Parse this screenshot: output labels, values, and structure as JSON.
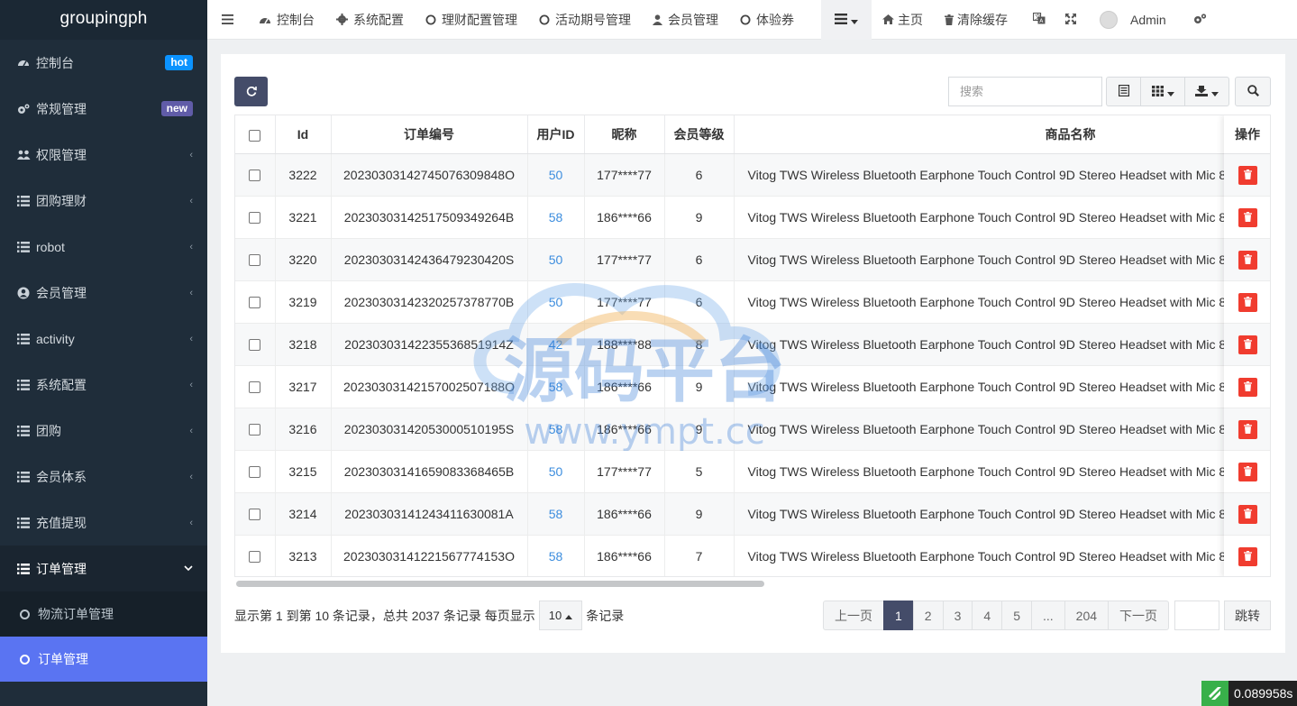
{
  "sidebar": {
    "logo": "groupingph",
    "items": [
      {
        "label": "控制台",
        "icon": "dashboard-icon",
        "badge": "hot"
      },
      {
        "label": "常规管理",
        "icon": "cogs-icon",
        "badge": "new"
      },
      {
        "label": "权限管理",
        "icon": "users-icon"
      },
      {
        "label": "团购理财",
        "icon": "list-icon"
      },
      {
        "label": "robot",
        "icon": "list-icon"
      },
      {
        "label": "会员管理",
        "icon": "user-circle-icon"
      },
      {
        "label": "activity",
        "icon": "list-icon"
      },
      {
        "label": "系统配置",
        "icon": "list-icon"
      },
      {
        "label": "团购",
        "icon": "list-icon"
      },
      {
        "label": "会员体系",
        "icon": "list-icon"
      },
      {
        "label": "充值提现",
        "icon": "list-icon"
      },
      {
        "label": "订单管理",
        "icon": "list-icon"
      }
    ],
    "subitems": [
      {
        "label": "物流订单管理"
      },
      {
        "label": "订单管理"
      }
    ]
  },
  "topbar": {
    "items": [
      "控制台",
      "系统配置",
      "理财配置管理",
      "活动期号管理",
      "会员管理",
      "体验券"
    ],
    "home": "主页",
    "clear_cache": "清除缓存",
    "user": "Admin"
  },
  "toolbar": {
    "search_placeholder": "搜索"
  },
  "table": {
    "headers": [
      "Id",
      "订单编号",
      "用户ID",
      "昵称",
      "会员等级",
      "商品名称"
    ],
    "ops_header": "操作",
    "rows": [
      {
        "id": "3222",
        "order_no": "20230303142745076309848O",
        "user_id": "50",
        "nickname": "177****77",
        "level": "6",
        "product": "Vitog TWS Wireless Bluetooth Earphone Touch Control 9D Stereo Headset with Mic 8"
      },
      {
        "id": "3221",
        "order_no": "20230303142517509349264B",
        "user_id": "58",
        "nickname": "186****66",
        "level": "9",
        "product": "Vitog TWS Wireless Bluetooth Earphone Touch Control 9D Stereo Headset with Mic 8"
      },
      {
        "id": "3220",
        "order_no": "20230303142436479230420S",
        "user_id": "50",
        "nickname": "177****77",
        "level": "6",
        "product": "Vitog TWS Wireless Bluetooth Earphone Touch Control 9D Stereo Headset with Mic 8"
      },
      {
        "id": "3219",
        "order_no": "20230303142320257378770B",
        "user_id": "50",
        "nickname": "177****77",
        "level": "6",
        "product": "Vitog TWS Wireless Bluetooth Earphone Touch Control 9D Stereo Headset with Mic 8"
      },
      {
        "id": "3218",
        "order_no": "20230303142235536851914Z",
        "user_id": "42",
        "nickname": "188****88",
        "level": "8",
        "product": "Vitog TWS Wireless Bluetooth Earphone Touch Control 9D Stereo Headset with Mic 8"
      },
      {
        "id": "3217",
        "order_no": "20230303142157002507188O",
        "user_id": "58",
        "nickname": "186****66",
        "level": "9",
        "product": "Vitog TWS Wireless Bluetooth Earphone Touch Control 9D Stereo Headset with Mic 8"
      },
      {
        "id": "3216",
        "order_no": "20230303142053000510195S",
        "user_id": "58",
        "nickname": "186****66",
        "level": "9",
        "product": "Vitog TWS Wireless Bluetooth Earphone Touch Control 9D Stereo Headset with Mic 8"
      },
      {
        "id": "3215",
        "order_no": "20230303141659083368465B",
        "user_id": "50",
        "nickname": "177****77",
        "level": "5",
        "product": "Vitog TWS Wireless Bluetooth Earphone Touch Control 9D Stereo Headset with Mic 8"
      },
      {
        "id": "3214",
        "order_no": "20230303141243411630081A",
        "user_id": "58",
        "nickname": "186****66",
        "level": "9",
        "product": "Vitog TWS Wireless Bluetooth Earphone Touch Control 9D Stereo Headset with Mic 8"
      },
      {
        "id": "3213",
        "order_no": "20230303141221567774153O",
        "user_id": "58",
        "nickname": "186****66",
        "level": "7",
        "product": "Vitog TWS Wireless Bluetooth Earphone Touch Control 9D Stereo Headset with Mic 8"
      }
    ]
  },
  "pager": {
    "info_prefix": "显示第 1 到第 10 条记录，总共 2037 条记录 每页显示",
    "page_size": "10",
    "info_suffix": "条记录",
    "prev": "上一页",
    "pages": [
      "1",
      "2",
      "3",
      "4",
      "5",
      "...",
      "204"
    ],
    "next": "下一页",
    "jump": "跳转"
  },
  "watermark": {
    "title": "源码平台",
    "url": "www.ympt.cc"
  },
  "timer": "0.089958s",
  "colors": {
    "sidebar_bg": "#1f2d3a",
    "accent": "#444c69",
    "active_sub": "#5a74f2",
    "link": "#3c8dde",
    "danger": "#f03c2f",
    "badge_hot": "#0b93ff",
    "badge_new": "#605ca8"
  }
}
